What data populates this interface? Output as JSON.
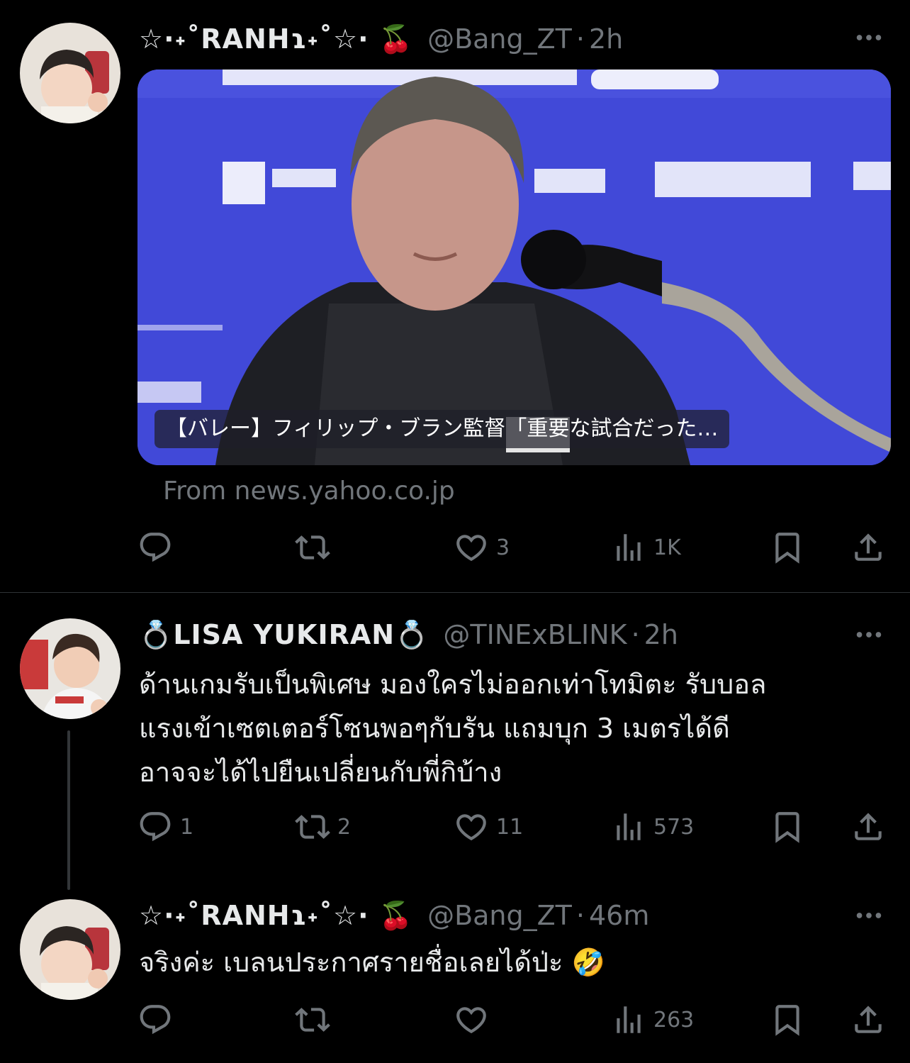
{
  "tweets": [
    {
      "display_name": "☆·˖˚RANHɿ˖˚☆· 🍒",
      "handle": "@Bang_ZT",
      "dot": "·",
      "time": "2h",
      "card": {
        "caption": "【バレー】フィリップ・ブラン監督「重要な試合だった…",
        "source": "From news.yahoo.co.jp"
      },
      "actions": {
        "reply": "",
        "retweet": "",
        "like": "3",
        "views": "1K"
      }
    },
    {
      "display_name": "💍LISA YUKIRAN💍",
      "handle": "@TINExBLINK",
      "dot": "·",
      "time": "2h",
      "text_lines": [
        "ด้านเกมรับเป็นพิเศษ มองใครไม่ออกเท่าโทมิตะ รับบอล",
        "แรงเข้าเซตเตอร์โซนพอๆกับรัน แถมบุก 3 เมตรได้ดี",
        "อาจจะได้ไปยืนเปลี่ยนกับพี่กิบ้าง"
      ],
      "actions": {
        "reply": "1",
        "retweet": "2",
        "like": "11",
        "views": "573"
      }
    },
    {
      "display_name": "☆·˖˚RANHɿ˖˚☆· 🍒",
      "handle": "@Bang_ZT",
      "dot": "·",
      "time": "46m",
      "text_lines": [
        "จริงค่ะ เบลนประกาศรายชื่อเลยได้ป่ะ 🤣"
      ],
      "actions": {
        "reply": "",
        "retweet": "",
        "like": "",
        "views": "263"
      }
    }
  ],
  "icons": {
    "more": "more-horizontal-icon",
    "reply": "reply-icon",
    "retweet": "retweet-icon",
    "like": "heart-icon",
    "views": "views-chart-icon",
    "bookmark": "bookmark-icon",
    "share": "share-icon"
  },
  "colors": {
    "background": "#000000",
    "text": "#e7e9ea",
    "muted": "#71767b",
    "divider": "#2f3336"
  }
}
